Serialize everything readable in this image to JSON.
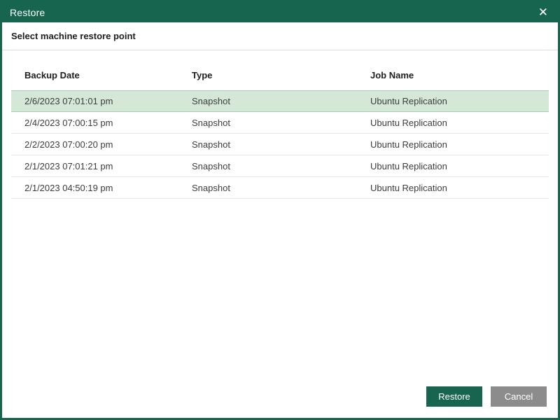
{
  "dialog": {
    "title": "Restore",
    "close_glyph": "✕",
    "subtitle": "Select machine restore point"
  },
  "table": {
    "columns": {
      "backup_date": "Backup Date",
      "type": "Type",
      "job_name": "Job Name"
    },
    "rows": [
      {
        "backup_date": "2/6/2023 07:01:01 pm",
        "type": "Snapshot",
        "job_name": "Ubuntu Replication",
        "selected": true
      },
      {
        "backup_date": "2/4/2023 07:00:15 pm",
        "type": "Snapshot",
        "job_name": "Ubuntu Replication",
        "selected": false
      },
      {
        "backup_date": "2/2/2023 07:00:20 pm",
        "type": "Snapshot",
        "job_name": "Ubuntu Replication",
        "selected": false
      },
      {
        "backup_date": "2/1/2023 07:01:21 pm",
        "type": "Snapshot",
        "job_name": "Ubuntu Replication",
        "selected": false
      },
      {
        "backup_date": "2/1/2023 04:50:19 pm",
        "type": "Snapshot",
        "job_name": "Ubuntu Replication",
        "selected": false
      }
    ]
  },
  "buttons": {
    "restore": "Restore",
    "cancel": "Cancel"
  },
  "colors": {
    "accent_green": "#17654f",
    "selected_row_bg": "#d5e8d8",
    "selected_row_border": "#a9cbb2",
    "cancel_gray": "#8c8c8c"
  }
}
